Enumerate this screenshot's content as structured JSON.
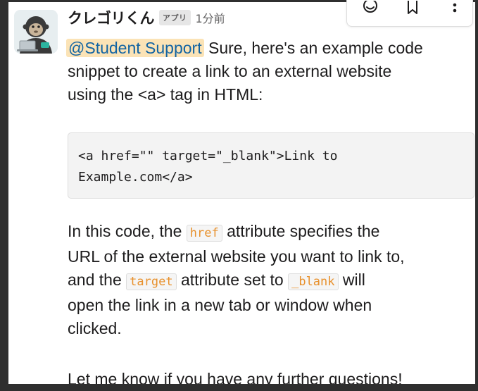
{
  "message": {
    "author": "クレゴリくん",
    "app_badge": "アプリ",
    "timestamp": "1分前",
    "mention": "@Student Support",
    "intro_line1_rest": " Sure, here's an example code",
    "intro_line2": "snippet to create a link to an external website",
    "intro_line3": "using the <a> tag in HTML:",
    "code_snippet": "<a href=\"\" target=\"_blank\">Link to\nExample.com</a>",
    "explain": {
      "p1": "In this code, the ",
      "code_href": "href",
      "p2": " attribute specifies the",
      "line2": "URL of the external website you want to link to,",
      "p3": "and the ",
      "code_target": "target",
      "p4": " attribute set to ",
      "code_blank": "_blank",
      "p5": " will",
      "line4": "open the link in a new tab or window when",
      "line5": "clicked."
    },
    "closing": "Let me know if you have any further questions!"
  },
  "toolbar": {
    "icons": [
      "emoji-reaction-icon",
      "bookmark-icon",
      "more-actions-icon"
    ]
  },
  "colors": {
    "mention_bg": "#fbe3b6",
    "mention_text": "#1264a3",
    "inline_code_text": "#e8912d",
    "code_block_bg": "#f3f3f3"
  }
}
